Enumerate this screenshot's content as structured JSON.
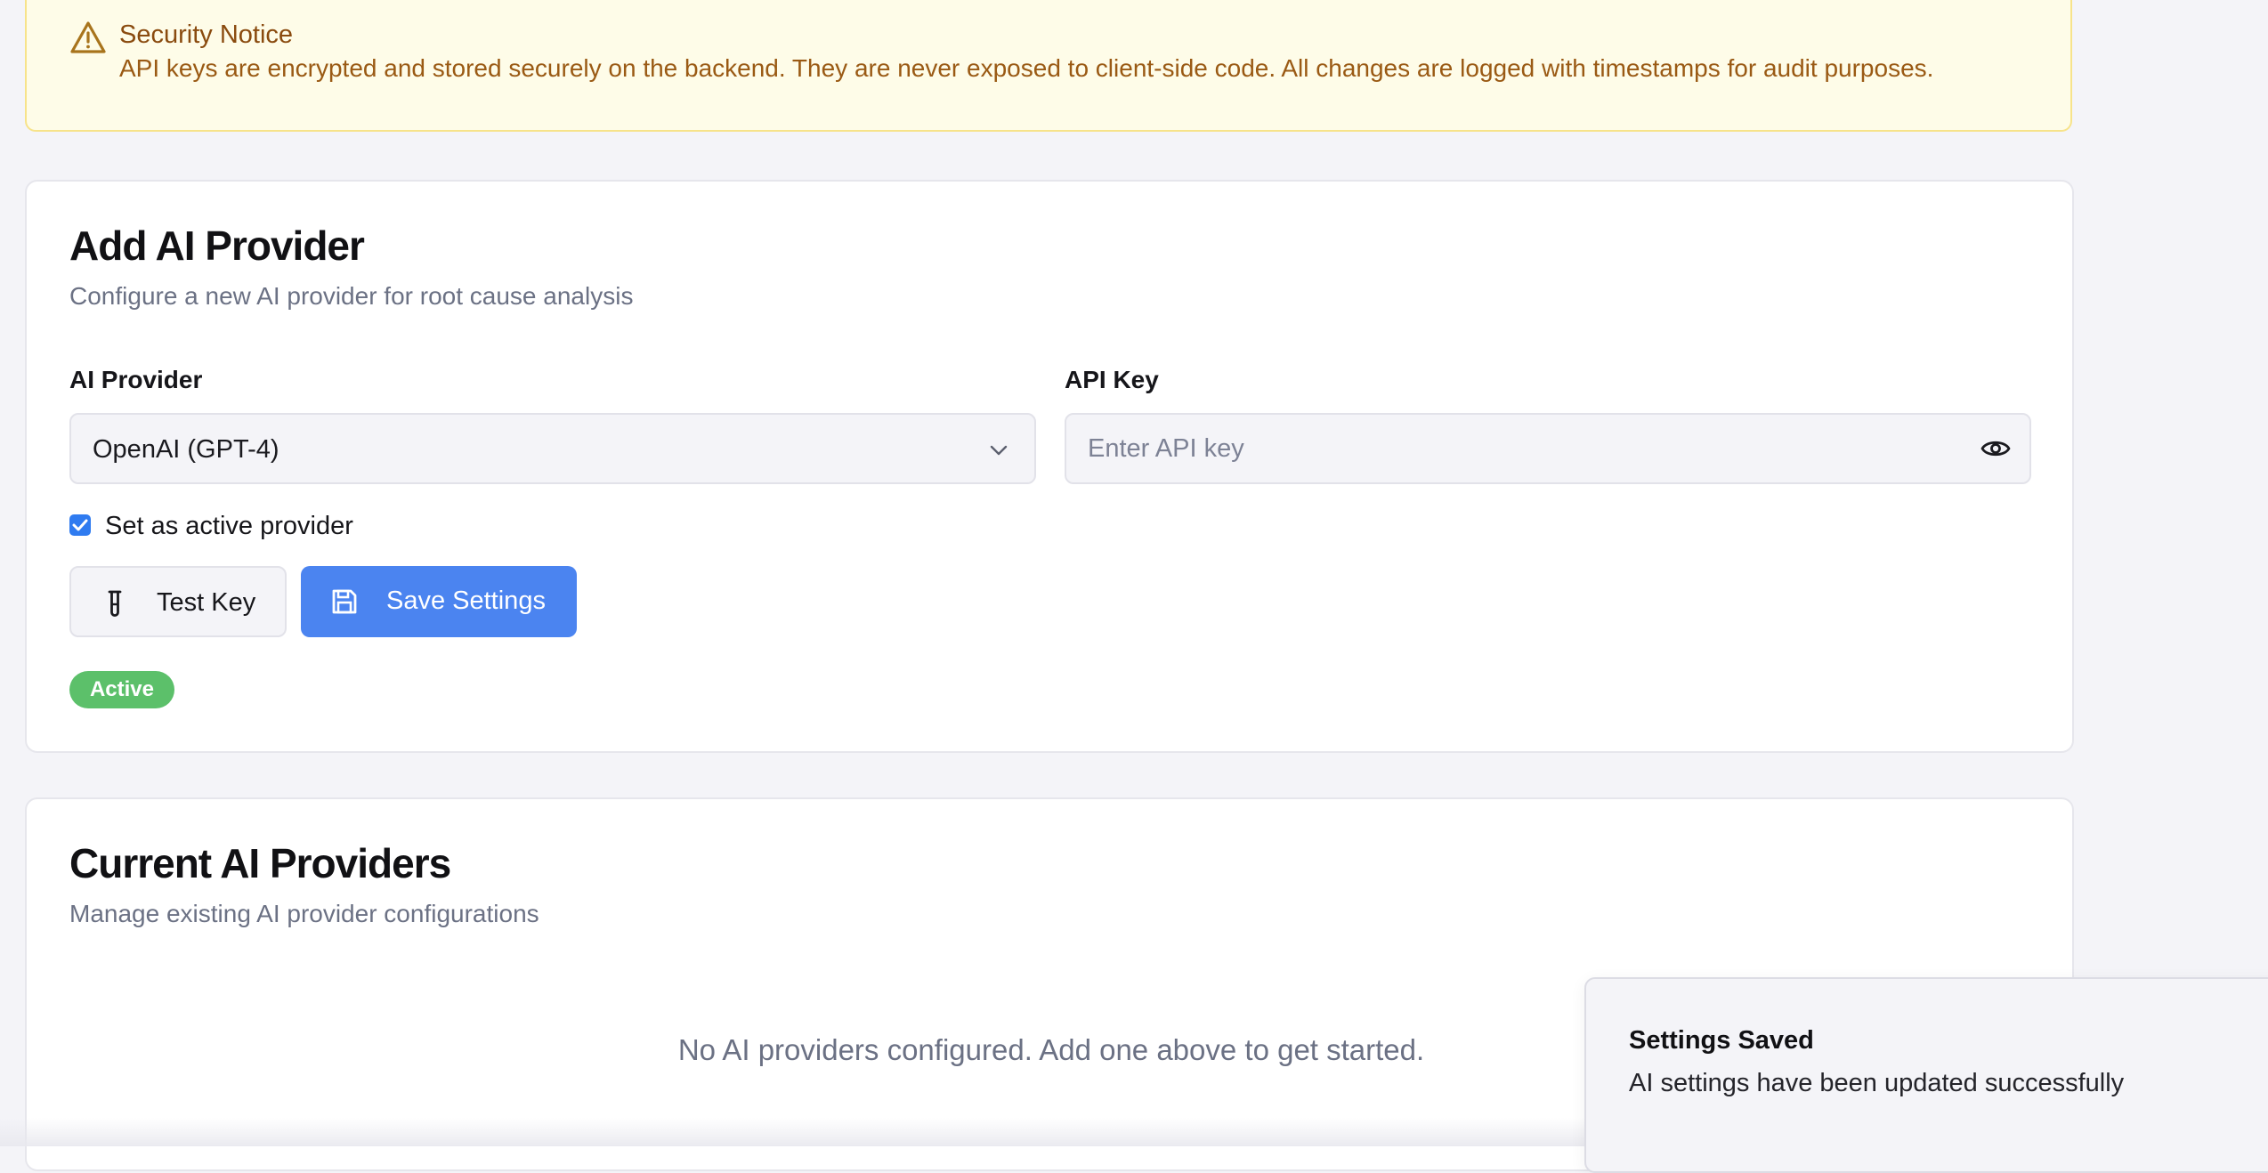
{
  "notice": {
    "icon": "warning-triangle-icon",
    "title": "Security Notice",
    "text": "API keys are encrypted and stored securely on the backend. They are never exposed to client-side code. All changes are logged with timestamps for audit purposes."
  },
  "add_provider": {
    "title": "Add AI Provider",
    "subtitle": "Configure a new AI provider for root cause analysis",
    "provider_label": "AI Provider",
    "provider_value": "OpenAI (GPT-4)",
    "api_key_label": "API Key",
    "api_key_value": "",
    "api_key_placeholder": "Enter API key",
    "active_checkbox_label": "Set as active provider",
    "active_checkbox_checked": true,
    "test_button_label": "Test Key",
    "save_button_label": "Save Settings",
    "status_badge": "Active"
  },
  "current_providers": {
    "title": "Current AI Providers",
    "subtitle": "Manage existing AI provider configurations",
    "empty_message": "No AI providers configured. Add one above to get started."
  },
  "toast": {
    "title": "Settings Saved",
    "message": "AI settings have been updated successfully"
  },
  "colors": {
    "accent": "#4b84f0",
    "success": "#5cc06a",
    "notice_bg": "#fefce8",
    "notice_text": "#9a5a14"
  }
}
